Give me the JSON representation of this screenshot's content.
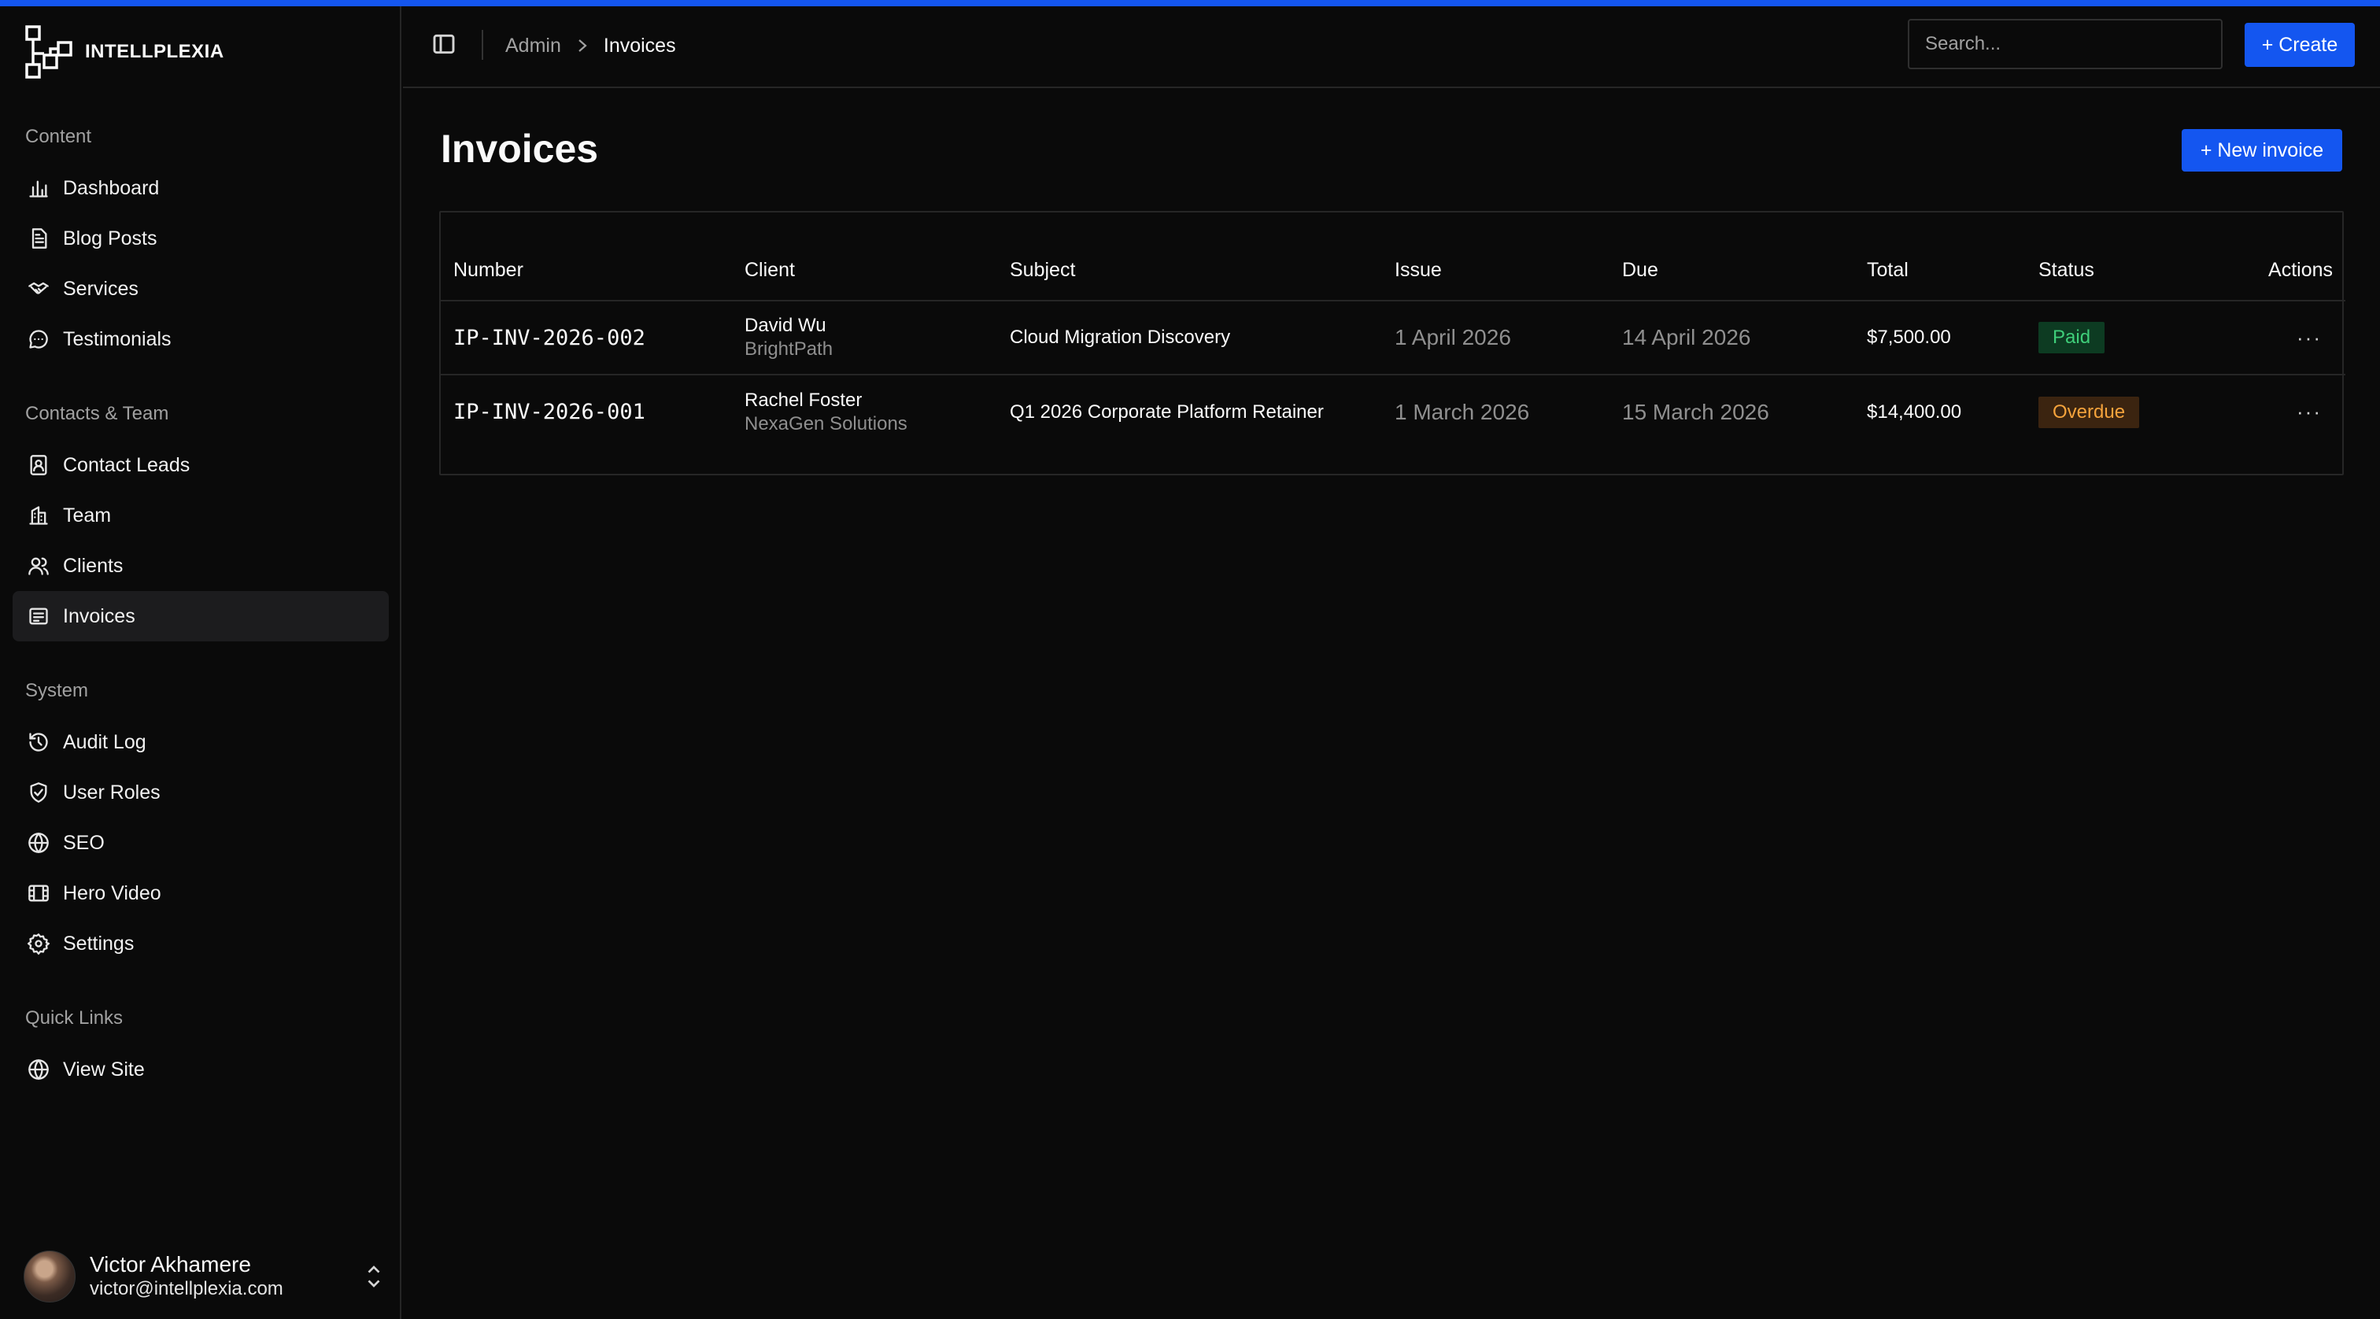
{
  "brand": {
    "name": "INTELLPLEXIA"
  },
  "sidebar": {
    "groups": [
      {
        "label": "Content",
        "items": [
          {
            "label": "Dashboard",
            "icon": "chart-icon"
          },
          {
            "label": "Blog Posts",
            "icon": "document-icon"
          },
          {
            "label": "Services",
            "icon": "handshake-icon"
          },
          {
            "label": "Testimonials",
            "icon": "chat-bubble-icon"
          }
        ]
      },
      {
        "label": "Contacts & Team",
        "items": [
          {
            "label": "Contact Leads",
            "icon": "contact-book-icon"
          },
          {
            "label": "Team",
            "icon": "building-icon"
          },
          {
            "label": "Clients",
            "icon": "users-icon"
          },
          {
            "label": "Invoices",
            "icon": "invoice-icon",
            "active": true
          }
        ]
      },
      {
        "label": "System",
        "items": [
          {
            "label": "Audit Log",
            "icon": "history-icon"
          },
          {
            "label": "User Roles",
            "icon": "shield-check-icon"
          },
          {
            "label": "SEO",
            "icon": "globe-icon"
          },
          {
            "label": "Hero Video",
            "icon": "film-icon"
          },
          {
            "label": "Settings",
            "icon": "gear-icon"
          }
        ]
      },
      {
        "label": "Quick Links",
        "items": [
          {
            "label": "View Site",
            "icon": "globe-icon"
          }
        ]
      }
    ]
  },
  "user": {
    "name": "Victor Akhamere",
    "email": "victor@intellplexia.com"
  },
  "header": {
    "breadcrumb": {
      "root": "Admin",
      "current": "Invoices"
    },
    "search_placeholder": "Search...",
    "create_label": "+ Create"
  },
  "main": {
    "title": "Invoices",
    "new_invoice_label": "+ New invoice",
    "table": {
      "columns": [
        "Number",
        "Client",
        "Subject",
        "Issue",
        "Due",
        "Total",
        "Status",
        "Actions"
      ],
      "rows": [
        {
          "number": "IP-INV-2026-002",
          "client_name": "David Wu",
          "client_company": "BrightPath",
          "subject": "Cloud Migration Discovery",
          "issue": "1 April 2026",
          "due": "14 April 2026",
          "total": "$7,500.00",
          "status": "Paid",
          "actions": "···"
        },
        {
          "number": "IP-INV-2026-001",
          "client_name": "Rachel Foster",
          "client_company": "NexaGen Solutions",
          "subject": "Q1 2026 Corporate Platform Retainer",
          "issue": "1 March 2026",
          "due": "15 March 2026",
          "total": "$14,400.00",
          "status": "Overdue",
          "actions": "···"
        }
      ]
    }
  },
  "colors": {
    "accent": "#1456f0",
    "paid": "#3fcf7a",
    "overdue": "#f5a33c",
    "background": "#0a0a0a"
  }
}
